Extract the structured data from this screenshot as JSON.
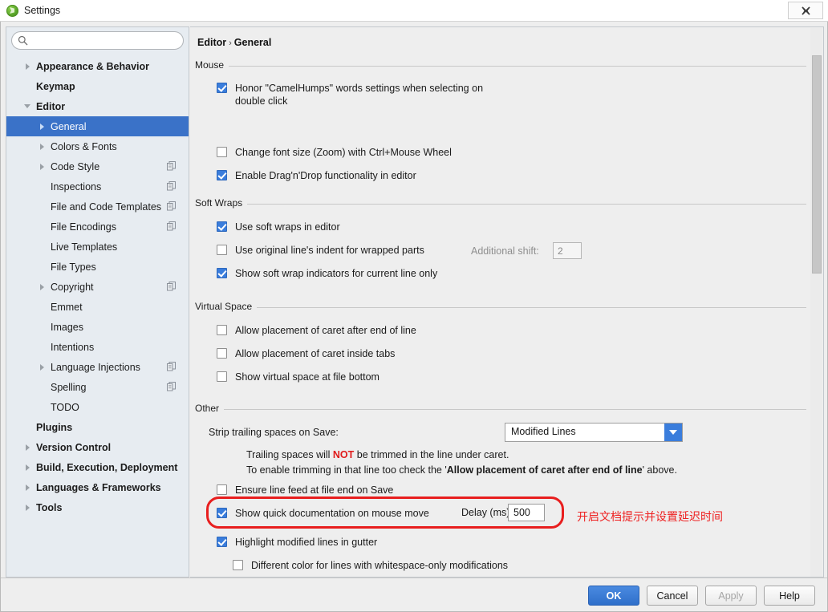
{
  "window": {
    "title": "Settings",
    "app_icon": "pycharm-icon",
    "close_label": "✖"
  },
  "sidebar": {
    "search": {
      "value": "",
      "placeholder": "",
      "icon": "search-icon"
    },
    "items": [
      {
        "label": "Appearance & Behavior",
        "indent": 0,
        "bold": true,
        "arrow": "right",
        "copy": false,
        "selected": false
      },
      {
        "label": "Keymap",
        "indent": 0,
        "bold": true,
        "arrow": "none",
        "copy": false,
        "selected": false
      },
      {
        "label": "Editor",
        "indent": 0,
        "bold": true,
        "arrow": "down",
        "copy": false,
        "selected": false
      },
      {
        "label": "General",
        "indent": 1,
        "bold": false,
        "arrow": "right",
        "copy": false,
        "selected": true
      },
      {
        "label": "Colors & Fonts",
        "indent": 1,
        "bold": false,
        "arrow": "right",
        "copy": false,
        "selected": false
      },
      {
        "label": "Code Style",
        "indent": 1,
        "bold": false,
        "arrow": "right",
        "copy": true,
        "selected": false
      },
      {
        "label": "Inspections",
        "indent": 1,
        "bold": false,
        "arrow": "none",
        "copy": true,
        "selected": false
      },
      {
        "label": "File and Code Templates",
        "indent": 1,
        "bold": false,
        "arrow": "none",
        "copy": true,
        "selected": false
      },
      {
        "label": "File Encodings",
        "indent": 1,
        "bold": false,
        "arrow": "none",
        "copy": true,
        "selected": false
      },
      {
        "label": "Live Templates",
        "indent": 1,
        "bold": false,
        "arrow": "none",
        "copy": false,
        "selected": false
      },
      {
        "label": "File Types",
        "indent": 1,
        "bold": false,
        "arrow": "none",
        "copy": false,
        "selected": false
      },
      {
        "label": "Copyright",
        "indent": 1,
        "bold": false,
        "arrow": "right",
        "copy": true,
        "selected": false
      },
      {
        "label": "Emmet",
        "indent": 1,
        "bold": false,
        "arrow": "none",
        "copy": false,
        "selected": false
      },
      {
        "label": "Images",
        "indent": 1,
        "bold": false,
        "arrow": "none",
        "copy": false,
        "selected": false
      },
      {
        "label": "Intentions",
        "indent": 1,
        "bold": false,
        "arrow": "none",
        "copy": false,
        "selected": false
      },
      {
        "label": "Language Injections",
        "indent": 1,
        "bold": false,
        "arrow": "right",
        "copy": true,
        "selected": false
      },
      {
        "label": "Spelling",
        "indent": 1,
        "bold": false,
        "arrow": "none",
        "copy": true,
        "selected": false
      },
      {
        "label": "TODO",
        "indent": 1,
        "bold": false,
        "arrow": "none",
        "copy": false,
        "selected": false
      },
      {
        "label": "Plugins",
        "indent": 0,
        "bold": true,
        "arrow": "none",
        "copy": false,
        "selected": false
      },
      {
        "label": "Version Control",
        "indent": 0,
        "bold": true,
        "arrow": "right",
        "copy": false,
        "selected": false
      },
      {
        "label": "Build, Execution, Deployment",
        "indent": 0,
        "bold": true,
        "arrow": "right",
        "copy": false,
        "selected": false
      },
      {
        "label": "Languages & Frameworks",
        "indent": 0,
        "bold": true,
        "arrow": "right",
        "copy": false,
        "selected": false
      },
      {
        "label": "Tools",
        "indent": 0,
        "bold": true,
        "arrow": "right",
        "copy": false,
        "selected": false
      }
    ]
  },
  "content": {
    "breadcrumb": {
      "root": "Editor",
      "separator": "›",
      "leaf": "General"
    },
    "groups": {
      "mouse": {
        "title": "Mouse",
        "options": [
          {
            "label": "Honor \"CamelHumps\" words settings when selecting on double click",
            "checked": true
          },
          {
            "label": "Change font size (Zoom) with Ctrl+Mouse Wheel",
            "checked": false
          },
          {
            "label": "Enable Drag'n'Drop functionality in editor",
            "checked": true
          }
        ]
      },
      "soft_wraps": {
        "title": "Soft Wraps",
        "options": [
          {
            "label": "Use soft wraps in editor",
            "checked": true
          },
          {
            "label": "Use original line's indent for wrapped parts",
            "checked": false
          },
          {
            "label": "Show soft wrap indicators for current line only",
            "checked": true
          }
        ],
        "additional_shift": {
          "label": "Additional shift:",
          "value": "2",
          "disabled": true
        }
      },
      "virtual_space": {
        "title": "Virtual Space",
        "options": [
          {
            "label": "Allow placement of caret after end of line",
            "checked": false
          },
          {
            "label": "Allow placement of caret inside tabs",
            "checked": false
          },
          {
            "label": "Show virtual space at file bottom",
            "checked": false
          }
        ]
      },
      "other": {
        "title": "Other",
        "strip_label": "Strip trailing spaces on Save:",
        "strip_value": "Modified Lines",
        "note_line1_a": "Trailing spaces will ",
        "note_line1_red": "NOT",
        "note_line1_b": " be trimmed in the line under caret.",
        "note_line2_a": "To enable trimming in that line too check the '",
        "note_line2_bold": "Allow placement of caret after end of line",
        "note_line2_b": "' above.",
        "options": [
          {
            "label": "Ensure line feed at file end on Save",
            "checked": false
          },
          {
            "label": "Show quick documentation on mouse move",
            "checked": true
          },
          {
            "label": "Highlight modified lines in gutter",
            "checked": true
          },
          {
            "label": "Different color for lines with whitespace-only modifications",
            "checked": false
          }
        ],
        "delay": {
          "label": "Delay (ms):",
          "value": "500"
        }
      }
    },
    "annotation": {
      "text": "开启文档提示并设置延迟时间",
      "color": "#ee2222"
    }
  },
  "footer": {
    "ok": "OK",
    "cancel": "Cancel",
    "apply": "Apply",
    "help": "Help"
  },
  "colors": {
    "accent": "#3a7ddc",
    "selection": "#3a72c8",
    "annotation_red": "#ee2222",
    "highlight_red": "#e81e1e"
  }
}
